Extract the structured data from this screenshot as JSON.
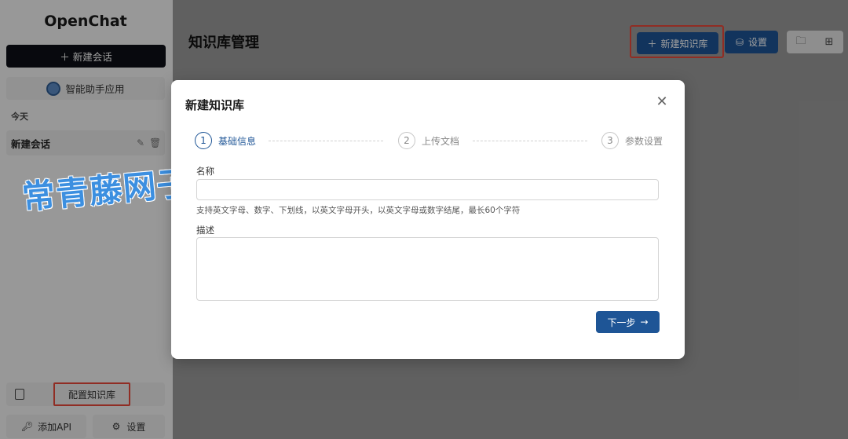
{
  "sidebar": {
    "app_title": "OpenChat",
    "new_chat": "新建会话",
    "assistant_apps": "智能助手应用",
    "section_today": "今天",
    "chat_items": [
      {
        "label": "新建会话"
      }
    ],
    "config_kb": "配置知识库",
    "add_api": "添加API",
    "settings": "设置"
  },
  "header": {
    "title": "知识库管理",
    "new_kb": "新建知识库",
    "settings": "设置"
  },
  "modal": {
    "title": "新建知识库",
    "steps": [
      {
        "num": "1",
        "label": "基础信息"
      },
      {
        "num": "2",
        "label": "上传文档"
      },
      {
        "num": "3",
        "label": "参数设置"
      }
    ],
    "name_label": "名称",
    "name_value": "",
    "name_hint": "支持英文字母、数字、下划线，以英文字母开头，以英文字母或数字结尾，最长60个字符",
    "desc_label": "描述",
    "desc_value": "",
    "next": "下一步"
  },
  "watermark": "常青藤网子",
  "colors": {
    "primary": "#1e5596",
    "highlight": "#e84a3a",
    "dark_button": "#0e1017"
  }
}
